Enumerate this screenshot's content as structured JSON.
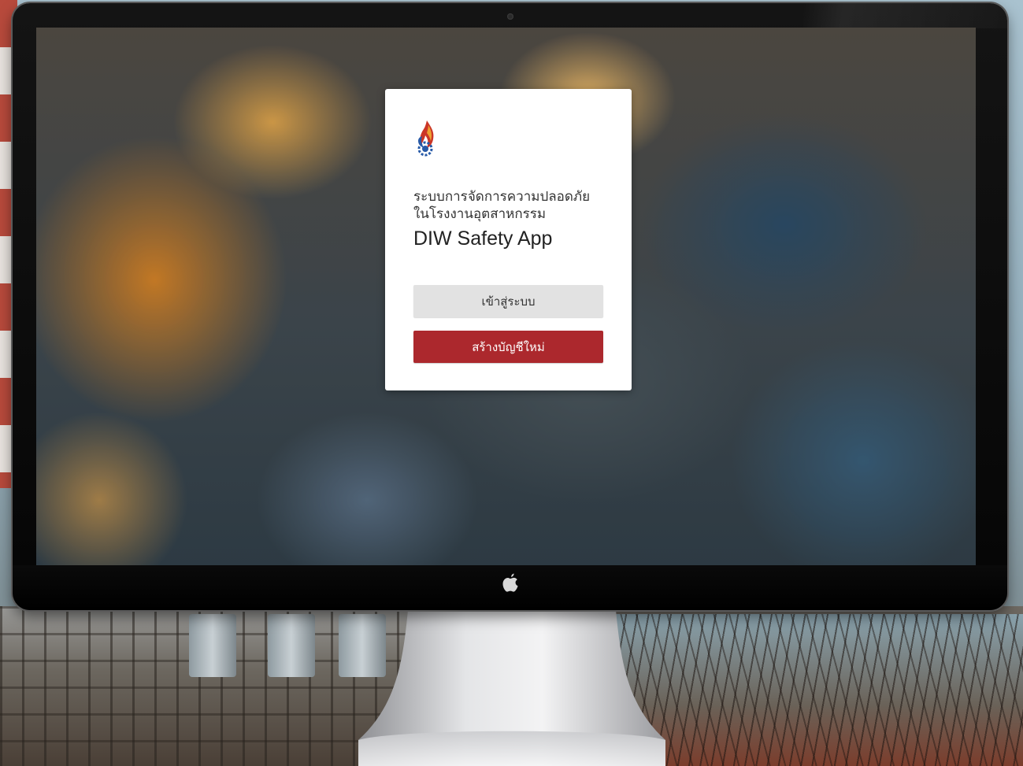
{
  "app": {
    "subtitle": "ระบบการจัดการความปลอดภัย\nในโรงงานอุตสาหกรรม",
    "title": "DIW Safety App"
  },
  "buttons": {
    "login_label": "เข้าสู่ระบบ",
    "register_label": "สร้างบัญชีใหม่"
  },
  "icons": {
    "app_logo": "diw-flame-gear-logo",
    "device_logo": "apple-logo"
  },
  "colors": {
    "register_button": "#a32b2f",
    "login_button": "#e2e2e2",
    "card_background": "#ffffff"
  }
}
